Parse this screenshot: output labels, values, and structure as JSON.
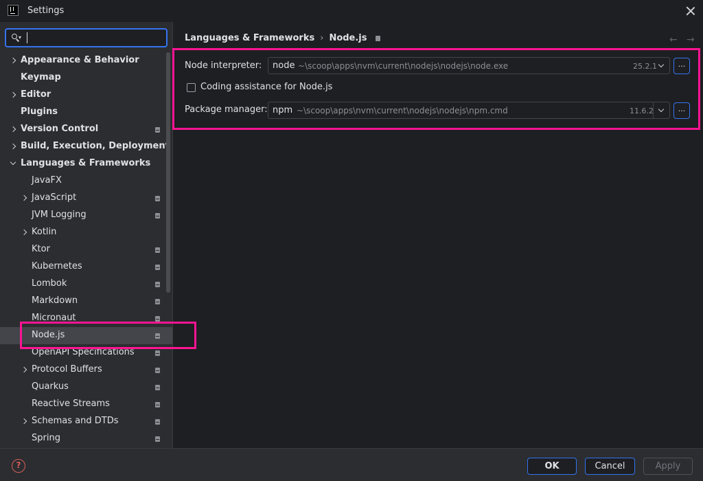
{
  "window": {
    "title": "Settings"
  },
  "search": {
    "value": "",
    "placeholder": ""
  },
  "sidebar": {
    "items": [
      {
        "label": "Appearance & Behavior",
        "bold": true,
        "chevron": "right",
        "level": 0,
        "project": false
      },
      {
        "label": "Keymap",
        "bold": true,
        "chevron": "none",
        "level": 0,
        "project": false
      },
      {
        "label": "Editor",
        "bold": true,
        "chevron": "right",
        "level": 0,
        "project": false
      },
      {
        "label": "Plugins",
        "bold": true,
        "chevron": "none",
        "level": 0,
        "project": false
      },
      {
        "label": "Version Control",
        "bold": true,
        "chevron": "right",
        "level": 0,
        "project": true
      },
      {
        "label": "Build, Execution, Deployment",
        "bold": true,
        "chevron": "right",
        "level": 0,
        "project": false
      },
      {
        "label": "Languages & Frameworks",
        "bold": true,
        "chevron": "down",
        "level": 0,
        "project": false
      },
      {
        "label": "JavaFX",
        "bold": false,
        "chevron": "none",
        "level": 1,
        "project": false
      },
      {
        "label": "JavaScript",
        "bold": false,
        "chevron": "right",
        "level": 1,
        "project": true
      },
      {
        "label": "JVM Logging",
        "bold": false,
        "chevron": "none",
        "level": 1,
        "project": true
      },
      {
        "label": "Kotlin",
        "bold": false,
        "chevron": "right",
        "level": 1,
        "project": false
      },
      {
        "label": "Ktor",
        "bold": false,
        "chevron": "none",
        "level": 1,
        "project": true
      },
      {
        "label": "Kubernetes",
        "bold": false,
        "chevron": "none",
        "level": 1,
        "project": true
      },
      {
        "label": "Lombok",
        "bold": false,
        "chevron": "none",
        "level": 1,
        "project": true
      },
      {
        "label": "Markdown",
        "bold": false,
        "chevron": "none",
        "level": 1,
        "project": true
      },
      {
        "label": "Micronaut",
        "bold": false,
        "chevron": "none",
        "level": 1,
        "project": true
      },
      {
        "label": "Node.js",
        "bold": false,
        "chevron": "none",
        "level": 1,
        "project": true,
        "selected": true
      },
      {
        "label": "OpenAPI Specifications",
        "bold": false,
        "chevron": "none",
        "level": 1,
        "project": true
      },
      {
        "label": "Protocol Buffers",
        "bold": false,
        "chevron": "right",
        "level": 1,
        "project": true
      },
      {
        "label": "Quarkus",
        "bold": false,
        "chevron": "none",
        "level": 1,
        "project": true
      },
      {
        "label": "Reactive Streams",
        "bold": false,
        "chevron": "none",
        "level": 1,
        "project": true
      },
      {
        "label": "Schemas and DTDs",
        "bold": false,
        "chevron": "right",
        "level": 1,
        "project": true
      },
      {
        "label": "Spring",
        "bold": false,
        "chevron": "none",
        "level": 1,
        "project": true
      }
    ]
  },
  "breadcrumb": {
    "parent": "Languages & Frameworks",
    "separator": "›",
    "current": "Node.js"
  },
  "nav": {
    "back": "←",
    "forward": "→"
  },
  "node_interpreter": {
    "label": "Node interpreter:",
    "name": "node",
    "path": "~\\scoop\\apps\\nvm\\current\\nodejs\\nodejs\\node.exe",
    "version": "25.2.1",
    "browse": "..."
  },
  "coding_assistance": {
    "label": "Coding assistance for Node.js",
    "checked": false
  },
  "package_manager": {
    "label": "Package manager:",
    "name": "npm",
    "path": "~\\scoop\\apps\\nvm\\current\\nodejs\\nodejs\\npm.cmd",
    "version": "11.6.2",
    "browse": "..."
  },
  "footer": {
    "help": "?",
    "ok": "OK",
    "cancel": "Cancel",
    "apply": "Apply"
  },
  "colors": {
    "accent": "#3574f0",
    "highlight": "#ff1493",
    "help": "#db5c5c"
  }
}
